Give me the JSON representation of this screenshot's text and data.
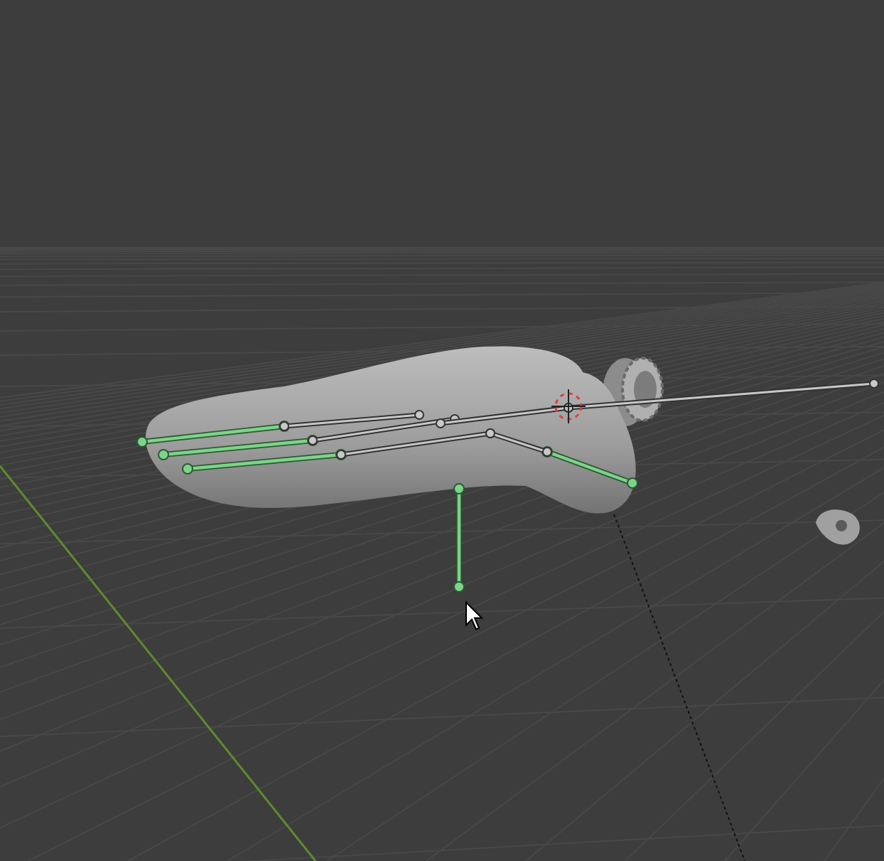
{
  "viewport": {
    "bones": [
      {
        "selected": true
      },
      {
        "selected": true
      },
      {
        "selected": true
      },
      {
        "selected": true
      },
      {
        "selected": true
      },
      {
        "selected": false
      },
      {
        "selected": false
      },
      {
        "selected": false
      },
      {
        "selected": false
      },
      {
        "selected": false
      },
      {
        "selected": false
      }
    ]
  }
}
